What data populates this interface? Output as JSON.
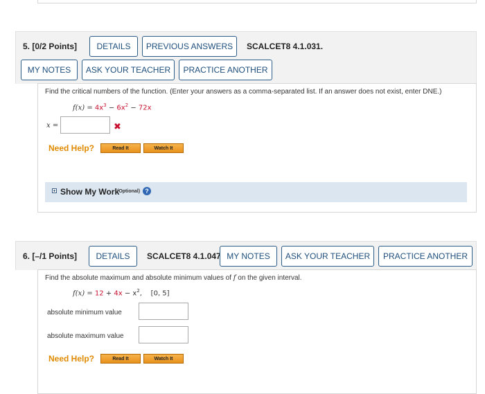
{
  "q5": {
    "number_label": "5.",
    "points": "[0/2 Points]",
    "details_label": "DETAILS",
    "previous_answers_label": "PREVIOUS ANSWERS",
    "source": "SCALCET8 4.1.031.",
    "my_notes_label": "MY NOTES",
    "ask_teacher_label": "ASK YOUR TEACHER",
    "practice_another_label": "PRACTICE ANOTHER",
    "prompt": "Find the critical numbers of the function. (Enter your answers as a comma-separated list. If an answer does not exist, enter DNE.)",
    "function_lhs": "f(x) = ",
    "function_terms": [
      "4x",
      "3",
      " − ",
      "6x",
      "2",
      " − ",
      "72x"
    ],
    "answer_label": "x =",
    "answer_value": "",
    "incorrect_mark": "✖",
    "need_help": "Need Help?",
    "read_it": "Read It",
    "watch_it": "Watch It",
    "show_work": "Show My Work",
    "show_work_optional": "(Optional)",
    "help_icon": "?"
  },
  "q6": {
    "number_label": "6.",
    "points": "[–/1 Points]",
    "details_label": "DETAILS",
    "source": "SCALCET8 4.1.047.",
    "my_notes_label": "MY NOTES",
    "ask_teacher_label": "ASK YOUR TEACHER",
    "practice_another_label": "PRACTICE ANOTHER",
    "prompt_before": "Find the absolute maximum and absolute minimum values of ",
    "prompt_f": "f",
    "prompt_after": " on the given interval.",
    "function_lhs": "f(x) = ",
    "function_terms": [
      "12",
      " + ",
      "4x",
      " − x",
      "2",
      ",    [0, 5]"
    ],
    "min_label": "absolute minimum value",
    "min_value": "",
    "max_label": "absolute maximum value",
    "max_value": "",
    "need_help": "Need Help?",
    "read_it": "Read It",
    "watch_it": "Watch It"
  },
  "colors": {
    "button_border": "#2c5d8a",
    "header_bg": "#f2f2f2",
    "need_help": "#e08a00",
    "incorrect": "#c8102e",
    "show_work_bg": "#dce6f0"
  }
}
